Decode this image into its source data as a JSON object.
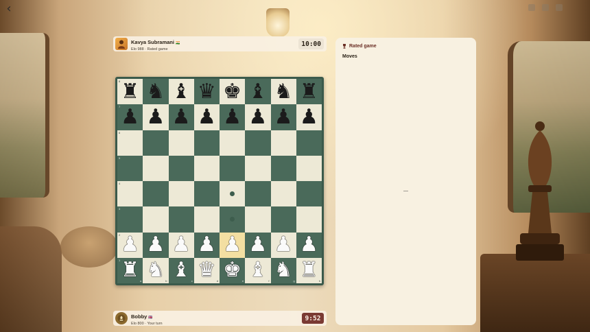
{
  "nav": {
    "back_label": "‹"
  },
  "opponent": {
    "name": "Kavya Subramani",
    "flag": "🇮🇳",
    "meta": "Elo 988 · Rated game",
    "clock": "10:00"
  },
  "me": {
    "name": "Bobby",
    "flag": "🇬🇧",
    "meta": "Elo 800 · Your turn",
    "clock": "9:52"
  },
  "panel": {
    "title": "Rated game",
    "moves_heading": "Moves",
    "moves_placeholder": "—"
  },
  "board": {
    "ranks": [
      {
        "label": "8",
        "squares": [
          {
            "piece": "♜",
            "side": "black"
          },
          {
            "piece": "♞",
            "side": "black"
          },
          {
            "piece": "♝",
            "side": "black"
          },
          {
            "piece": "♛",
            "side": "black"
          },
          {
            "piece": "♚",
            "side": "black"
          },
          {
            "piece": "♝",
            "side": "black"
          },
          {
            "piece": "♞",
            "side": "black"
          },
          {
            "piece": "♜",
            "side": "black"
          }
        ]
      },
      {
        "label": "7",
        "squares": [
          {
            "piece": "♟",
            "side": "black"
          },
          {
            "piece": "♟",
            "side": "black"
          },
          {
            "piece": "♟",
            "side": "black"
          },
          {
            "piece": "♟",
            "side": "black"
          },
          {
            "piece": "♟",
            "side": "black"
          },
          {
            "piece": "♟",
            "side": "black"
          },
          {
            "piece": "♟",
            "side": "black"
          },
          {
            "piece": "♟",
            "side": "black"
          }
        ]
      },
      {
        "label": "6",
        "squares": [
          {},
          {},
          {},
          {},
          {},
          {},
          {},
          {}
        ]
      },
      {
        "label": "5",
        "squares": [
          {},
          {},
          {},
          {},
          {},
          {},
          {},
          {}
        ]
      },
      {
        "label": "4",
        "squares": [
          {},
          {},
          {},
          {},
          {
            "dot": true
          },
          {},
          {},
          {}
        ]
      },
      {
        "label": "3",
        "squares": [
          {},
          {},
          {},
          {},
          {
            "dot": true
          },
          {},
          {},
          {}
        ]
      },
      {
        "label": "2",
        "squares": [
          {
            "piece": "♟",
            "side": "white"
          },
          {
            "piece": "♟",
            "side": "white"
          },
          {
            "piece": "♟",
            "side": "white"
          },
          {
            "piece": "♟",
            "side": "white"
          },
          {
            "piece": "♟",
            "side": "white",
            "highlight": true
          },
          {
            "piece": "♟",
            "side": "white"
          },
          {
            "piece": "♟",
            "side": "white"
          },
          {
            "piece": "♟",
            "side": "white"
          }
        ]
      },
      {
        "label": "1",
        "squares": [
          {
            "piece": "♜",
            "side": "white"
          },
          {
            "piece": "♞",
            "side": "white"
          },
          {
            "piece": "♝",
            "side": "white"
          },
          {
            "piece": "♛",
            "side": "white"
          },
          {
            "piece": "♚",
            "side": "white"
          },
          {
            "piece": "♝",
            "side": "white"
          },
          {
            "piece": "♞",
            "side": "white"
          },
          {
            "piece": "♜",
            "side": "white"
          }
        ]
      }
    ],
    "files": [
      "a",
      "b",
      "c",
      "d",
      "e",
      "f",
      "g",
      "h"
    ]
  },
  "colors": {
    "light_square": "#ede9d6",
    "dark_square": "#4a6a5a",
    "highlight_square": "#f3dfa2",
    "my_clock_bg": "#7a3a33",
    "panel_accent": "#6a2e24"
  }
}
